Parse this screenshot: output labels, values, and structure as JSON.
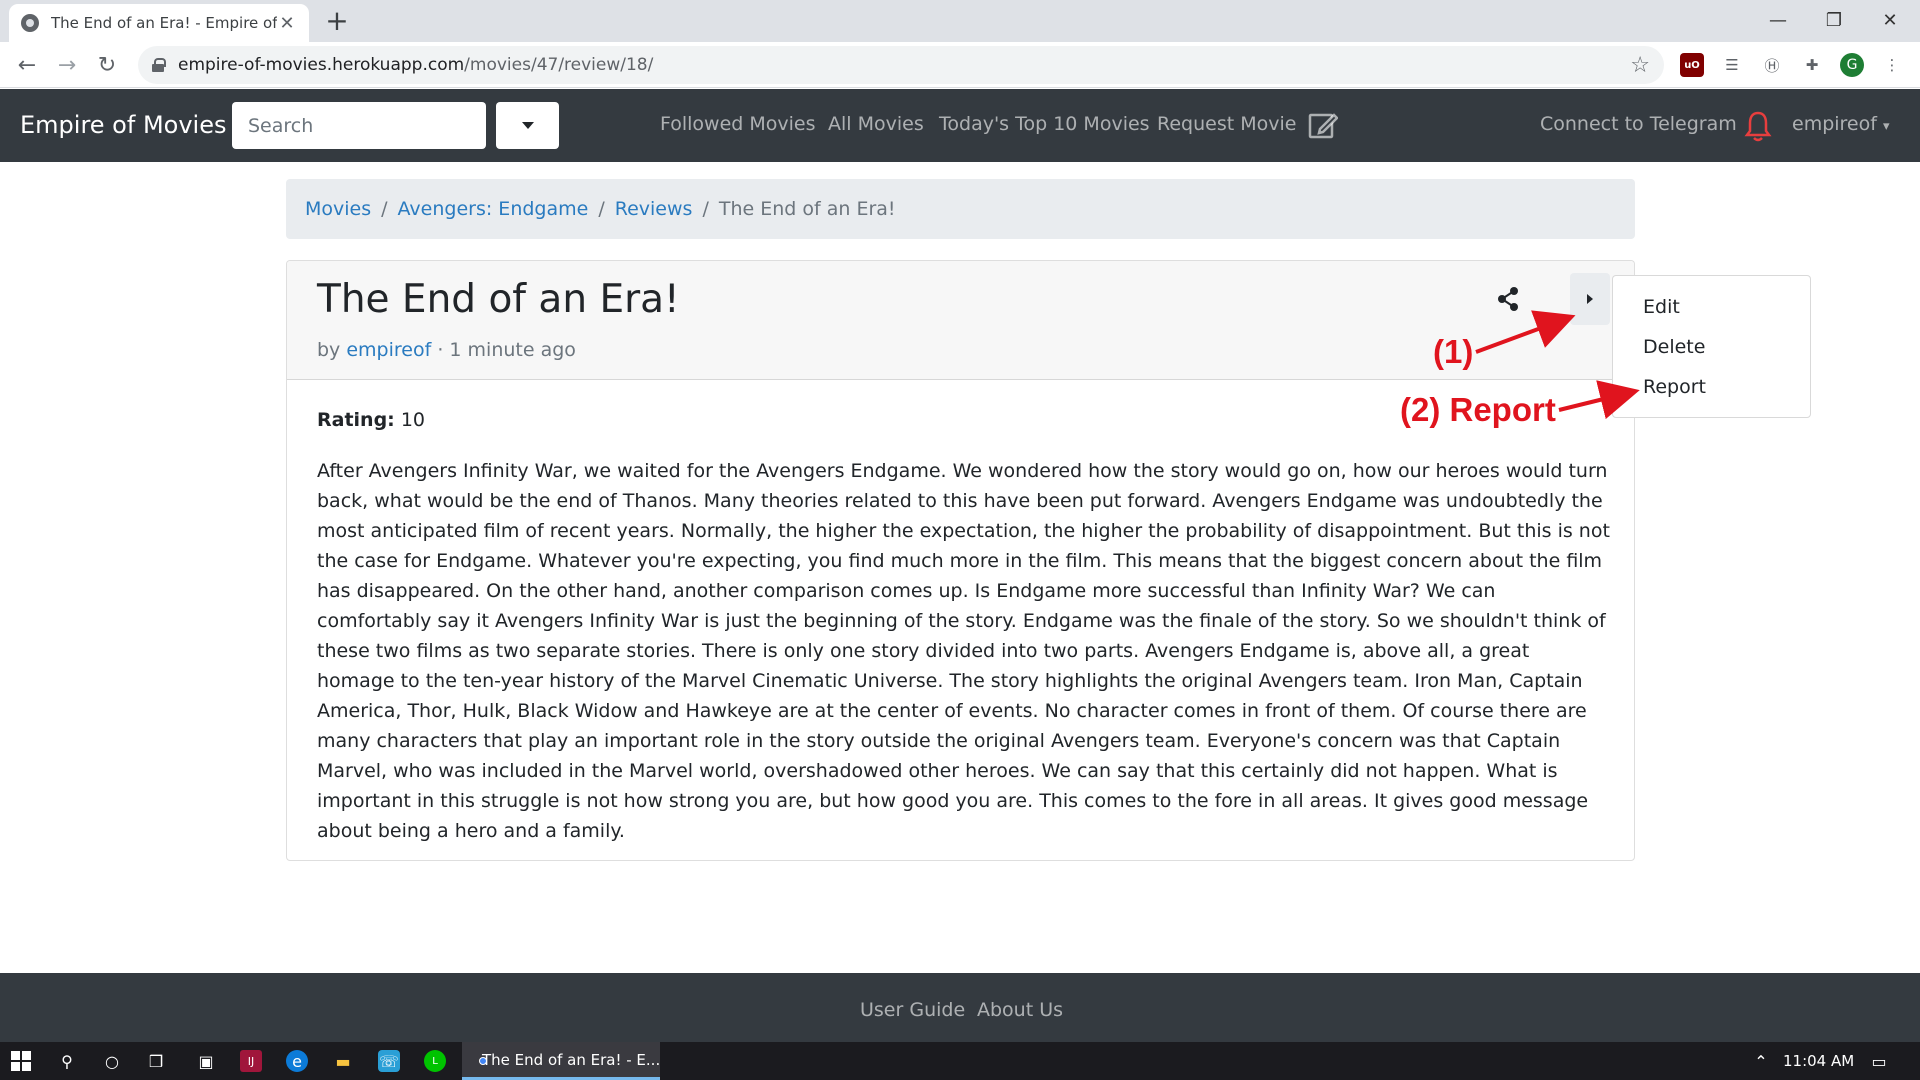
{
  "browser": {
    "tab_title": "The End of an Era! - Empire of M",
    "url_host": "empire-of-movies.herokuapp.com",
    "url_path": "/movies/47/review/18/",
    "profile_initial": "G"
  },
  "site": {
    "brand": "Empire of Movies",
    "search_placeholder": "Search",
    "nav": {
      "followed": "Followed Movies",
      "all": "All Movies",
      "top10": "Today's Top 10 Movies",
      "request": "Request Movie",
      "telegram": "Connect to Telegram",
      "user": "empireof"
    }
  },
  "breadcrumb": {
    "movies": "Movies",
    "movie": "Avengers: Endgame",
    "reviews": "Reviews",
    "current": "The End of an Era!",
    "separator": "/"
  },
  "review": {
    "title": "The End of an Era!",
    "by_prefix": "by",
    "author": "empireof",
    "time": "· 1 minute ago",
    "rating_label": "Rating:",
    "rating_value": "10",
    "body": "After Avengers Infinity War, we waited for the Avengers Endgame. We wondered how the story would go on, how our heroes would turn back, what would be the end of Thanos. Many theories related to this have been put forward. Avengers Endgame was undoubtedly the most anticipated film of recent years. Normally, the higher the expectation, the higher the probability of disappointment. But this is not the case for Endgame. Whatever you're expecting, you find much more in the film. This means that the biggest concern about the film has disappeared. On the other hand, another comparison comes up. Is Endgame more successful than Infinity War? We can comfortably say it Avengers Infinity War is just the beginning of the story. Endgame was the finale of the story. So we shouldn't think of these two films as two separate stories. There is only one story divided into two parts. Avengers Endgame is, above all, a great homage to the ten-year history of the Marvel Cinematic Universe. The story highlights the original Avengers team. Iron Man, Captain America, Thor, Hulk, Black Widow and Hawkeye are at the center of events. No character comes in front of them. Of course there are many characters that play an important role in the story outside the original Avengers team. Everyone's concern was that Captain Marvel, who was included in the Marvel world, overshadowed other heroes. We can say that this certainly did not happen. What is important in this struggle is not how strong you are, but how good you are. This comes to the fore in all areas. It gives good message about being a hero and a family."
  },
  "dropdown": {
    "edit": "Edit",
    "delete": "Delete",
    "report": "Report"
  },
  "annotations": {
    "step1": "(1)",
    "step2": "(2) Report",
    "color": "#e0141e"
  },
  "footer": {
    "guide": "User Guide",
    "about": "About Us"
  },
  "taskbar": {
    "app_title": "The End of an Era! - E...",
    "time": "11:04 AM"
  },
  "colors": {
    "navbar": "#343a40",
    "link": "#2a7bc0",
    "breadcrumb_bg": "#e9ecef"
  }
}
